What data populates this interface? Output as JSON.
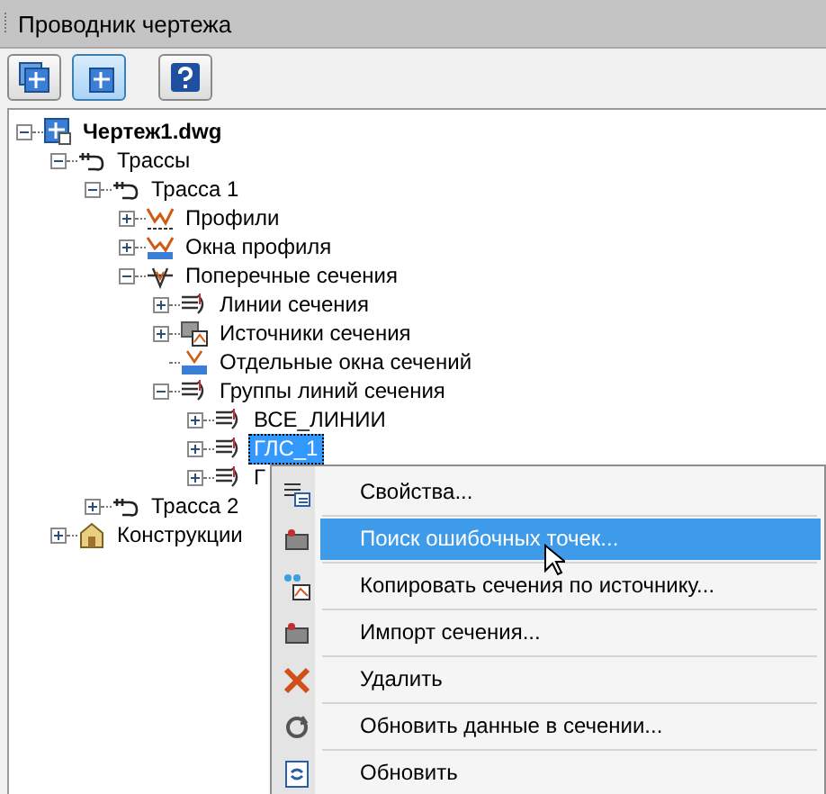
{
  "panel": {
    "title": "Проводник чертежа"
  },
  "toolbar": [
    {
      "kind": "tree",
      "pressed": false
    },
    {
      "kind": "tree-alt",
      "pressed": true
    },
    {
      "kind": "help",
      "pressed": false
    }
  ],
  "tree": [
    {
      "label": "Чертеж1.dwg",
      "kind": "drawing",
      "expanded": true,
      "selected": false,
      "children": [
        {
          "label": "Трассы",
          "kind": "alignments",
          "expanded": true,
          "selected": false,
          "children": [
            {
              "label": "Трасса 1",
              "kind": "alignment",
              "expanded": true,
              "selected": false,
              "children": [
                {
                  "label": "Профили",
                  "kind": "profiles",
                  "expanded": false,
                  "selected": false
                },
                {
                  "label": "Окна профиля",
                  "kind": "profile-views",
                  "expanded": false,
                  "selected": false
                },
                {
                  "label": "Поперечные сечения",
                  "kind": "sections",
                  "expanded": true,
                  "selected": false,
                  "children": [
                    {
                      "label": "Линии сечения",
                      "kind": "sample-lines",
                      "expanded": false,
                      "selected": false
                    },
                    {
                      "label": "Источники сечения",
                      "kind": "sources",
                      "expanded": false,
                      "selected": false
                    },
                    {
                      "label": "Отдельные окна сечений",
                      "kind": "section-views",
                      "selected": false
                    },
                    {
                      "label": "Группы линий сечения",
                      "kind": "sample-lines",
                      "expanded": true,
                      "selected": false,
                      "children": [
                        {
                          "label": "ВСЕ_ЛИНИИ",
                          "kind": "sample-lines",
                          "expanded": false,
                          "selected": false
                        },
                        {
                          "label": "ГЛС_1",
                          "kind": "sample-lines",
                          "expanded": false,
                          "selected": true
                        },
                        {
                          "label": "Г",
                          "kind": "sample-lines",
                          "expanded": false,
                          "selected": false
                        }
                      ]
                    }
                  ]
                }
              ]
            },
            {
              "label": "Трасса 2",
              "kind": "alignment",
              "expanded": false,
              "selected": false
            }
          ]
        },
        {
          "label": "Конструкции",
          "kind": "structures",
          "expanded": false,
          "selected": false
        }
      ]
    }
  ],
  "context_menu": [
    {
      "label": "Свойства...",
      "kind": "properties",
      "selected": false
    },
    {
      "label": "Поиск ошибочных точек...",
      "kind": "find",
      "selected": true
    },
    {
      "label": "Копировать сечения по источнику...",
      "kind": "copy",
      "selected": false
    },
    {
      "label": "Импорт сечения...",
      "kind": "import",
      "selected": false
    },
    {
      "label": "Удалить",
      "kind": "delete",
      "selected": false
    },
    {
      "label": "Обновить данные в сечении...",
      "kind": "update",
      "selected": false
    },
    {
      "label": "Обновить",
      "kind": "refresh",
      "selected": false
    }
  ]
}
